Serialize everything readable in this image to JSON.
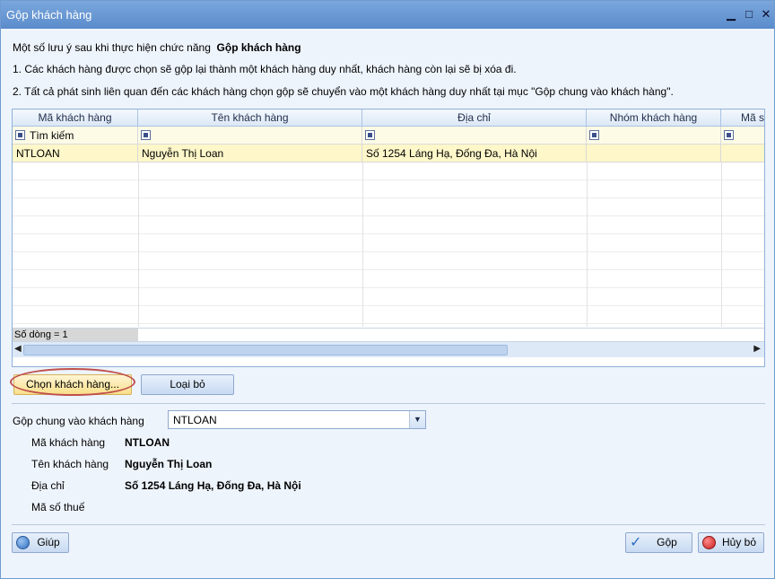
{
  "window": {
    "title": "Gộp khách hàng",
    "minimize_glyph": "▁",
    "maximize_glyph": "□",
    "close_glyph": "✕"
  },
  "notes": {
    "intro": "Một số lưu ý sau khi thực hiện chức năng",
    "intro_bold": "Gộp khách hàng",
    "line1": "1. Các khách hàng được chọn sẽ gộp lại thành một khách hàng duy nhất, khách hàng còn lại sẽ bị xóa đi.",
    "line2": "2. Tất cả phát sinh liên quan đến các khách hàng chọn gộp sẽ chuyển vào một khách hàng duy nhất tại mục \"Gộp chung vào khách hàng\"."
  },
  "grid": {
    "columns": [
      "Mã khách hàng",
      "Tên khách hàng",
      "Địa chỉ",
      "Nhóm khách hàng",
      "Mã số"
    ],
    "filter_placeholder": "Tìm kiếm",
    "rows": [
      [
        "NTLOAN",
        "Nguyễn Thị Loan",
        "Số 1254 Láng Hạ, Đống Đa, Hà Nội",
        "",
        ""
      ]
    ],
    "footer": "Số dòng = 1"
  },
  "buttons": {
    "select_customer": "Chọn khách hàng...",
    "remove": "Loại bỏ",
    "help": "Giúp",
    "merge": "Gộp",
    "cancel": "Hủy bỏ"
  },
  "merge_into": {
    "label": "Gộp chung vào khách hàng",
    "value": "NTLOAN"
  },
  "details": {
    "code_label": "Mã khách hàng",
    "code_value": "NTLOAN",
    "name_label": "Tên khách hàng",
    "name_value": "Nguyễn Thị Loan",
    "address_label": "Địa chỉ",
    "address_value": "Số 1254 Láng Hạ, Đống Đa, Hà Nội",
    "tax_label": "Mã số thuế",
    "tax_value": ""
  },
  "colors": {
    "titlebar": "#6a98d4",
    "selected_row": "#fdf7c9",
    "highlight_ellipse": "#c0504d"
  }
}
